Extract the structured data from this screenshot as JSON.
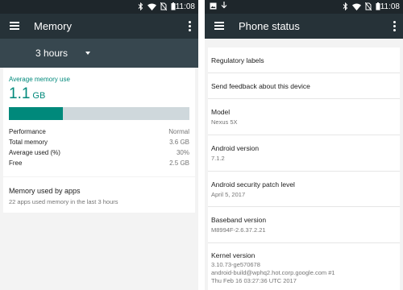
{
  "status_bar": {
    "time": "11:08"
  },
  "left": {
    "title": "Memory",
    "period": "3 hours",
    "average_label": "Average memory use",
    "average_value": "1.1",
    "average_unit": "GB",
    "usage_fraction": 0.3,
    "stats": [
      {
        "label": "Performance",
        "value": "Normal"
      },
      {
        "label": "Total memory",
        "value": "3.6 GB"
      },
      {
        "label": "Average used (%)",
        "value": "30%"
      },
      {
        "label": "Free",
        "value": "2.5 GB"
      }
    ],
    "apps": {
      "title": "Memory used by apps",
      "subtitle": "22 apps used memory in the last 3 hours"
    }
  },
  "right": {
    "title": "Phone status",
    "items": [
      {
        "title": "Regulatory labels",
        "subtitle": ""
      },
      {
        "title": "Send feedback about this device",
        "subtitle": ""
      },
      {
        "title": "Model",
        "subtitle": "Nexus 5X"
      },
      {
        "title": "Android version",
        "subtitle": "7.1.2"
      },
      {
        "title": "Android security patch level",
        "subtitle": "April 5, 2017"
      },
      {
        "title": "Baseband version",
        "subtitle": "M8994F-2.6.37.2.21"
      },
      {
        "title": "Kernel version",
        "subtitle": "3.10.73-ge570678\nandroid-build@wphq2.hot.corp.google.com #1\nThu Feb 16 03:27:36 UTC 2017"
      }
    ]
  },
  "icons": {
    "left_status": [
      "bluetooth-icon",
      "wifi-icon",
      "no-sim-icon",
      "battery-icon"
    ],
    "right_status_left": [
      "image-icon",
      "download-icon"
    ],
    "right_status": [
      "bluetooth-icon",
      "wifi-icon",
      "no-sim-icon",
      "battery-icon"
    ]
  },
  "colors": {
    "accent": "#00897b",
    "appbar": "#263238",
    "statusbar": "#1e262b",
    "subbar": "#37474f"
  }
}
